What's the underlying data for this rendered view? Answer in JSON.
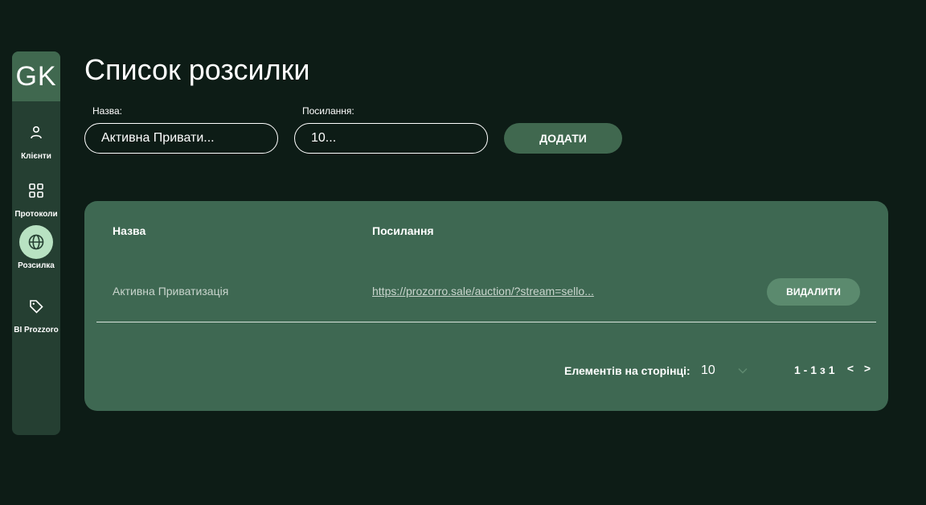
{
  "sidebar": {
    "avatar": "GK",
    "items": [
      {
        "label": "Клієнти",
        "icon": "user-icon"
      },
      {
        "label": "Протоколи",
        "icon": "grid-icon"
      },
      {
        "label": "Розсилка",
        "icon": "globe-icon",
        "active": true
      },
      {
        "label": "BI Prozzoro",
        "icon": "tag-icon"
      }
    ]
  },
  "page": {
    "title": "Список розсилки"
  },
  "form": {
    "name_label": "Назва:",
    "name_value": "Активна Привати...",
    "link_label": "Посилання:",
    "link_value": "10...",
    "add_label": "ДОДАТИ"
  },
  "table": {
    "headers": [
      "Назва",
      "Посилання"
    ],
    "rows": [
      {
        "name": "Активна Приватизація",
        "link": "https://prozorro.sale/auction/?stream=sello...",
        "delete_label": "ВИДАЛИТИ"
      }
    ]
  },
  "pagination": {
    "per_page_label": "Елементів на сторінці:",
    "per_page_value": "10",
    "range": "1 - 1 з 1",
    "prev": "<",
    "next": ">"
  },
  "colors": {
    "background": "#0d1c16",
    "sidebar": "#253f32",
    "accent": "#40684f",
    "card": "#3e6852",
    "active_nav": "#b8e2c2"
  }
}
